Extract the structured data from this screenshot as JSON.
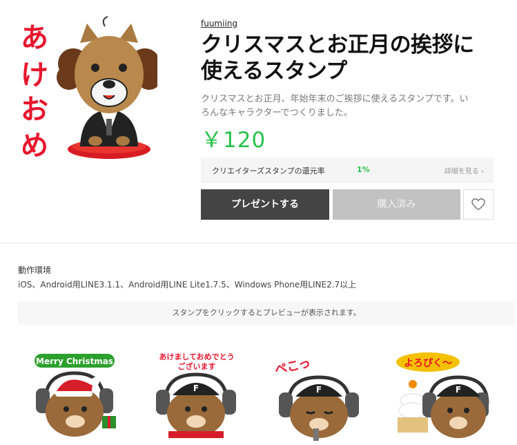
{
  "product": {
    "author": "fuumiing",
    "title_line1": "クリスマスとお正月の挨拶に",
    "title_line2": "使えるスタンプ",
    "description_line1": "クリスマスとお正月、年始年末のご挨拶に使えるスタンプです。い",
    "description_line2": "ろんなキャラクターでつくりました。",
    "price": "￥120",
    "main_sticker_text": [
      "あ",
      "け",
      "お",
      "め"
    ]
  },
  "rebate": {
    "label": "クリエイターズスタンプの還元率",
    "value": "1%",
    "link": "詳細を見る"
  },
  "buttons": {
    "present": "プレゼントする",
    "purchased": "購入済み",
    "like_icon": "heart-icon"
  },
  "environment": {
    "title": "動作環境",
    "text": "iOS、Android用LINE3.1.1、Android用LINE Lite1.7.5、Windows Phone用LINE2.7以上"
  },
  "preview_note": "スタンプをクリックするとプレビューが表示されます。",
  "stickers": [
    {
      "caption": "Merry Christmas"
    },
    {
      "caption_line1": "あけましておめでとう",
      "caption_line2": "ございます"
    },
    {
      "caption": "ぺこっ"
    },
    {
      "caption": "よろぴく〜"
    }
  ],
  "colors": {
    "price_green": "#27c34c",
    "main_sticker_text_red": "#e8162d",
    "present_button": "#444444",
    "purchased_button": "#c2c2c2"
  }
}
